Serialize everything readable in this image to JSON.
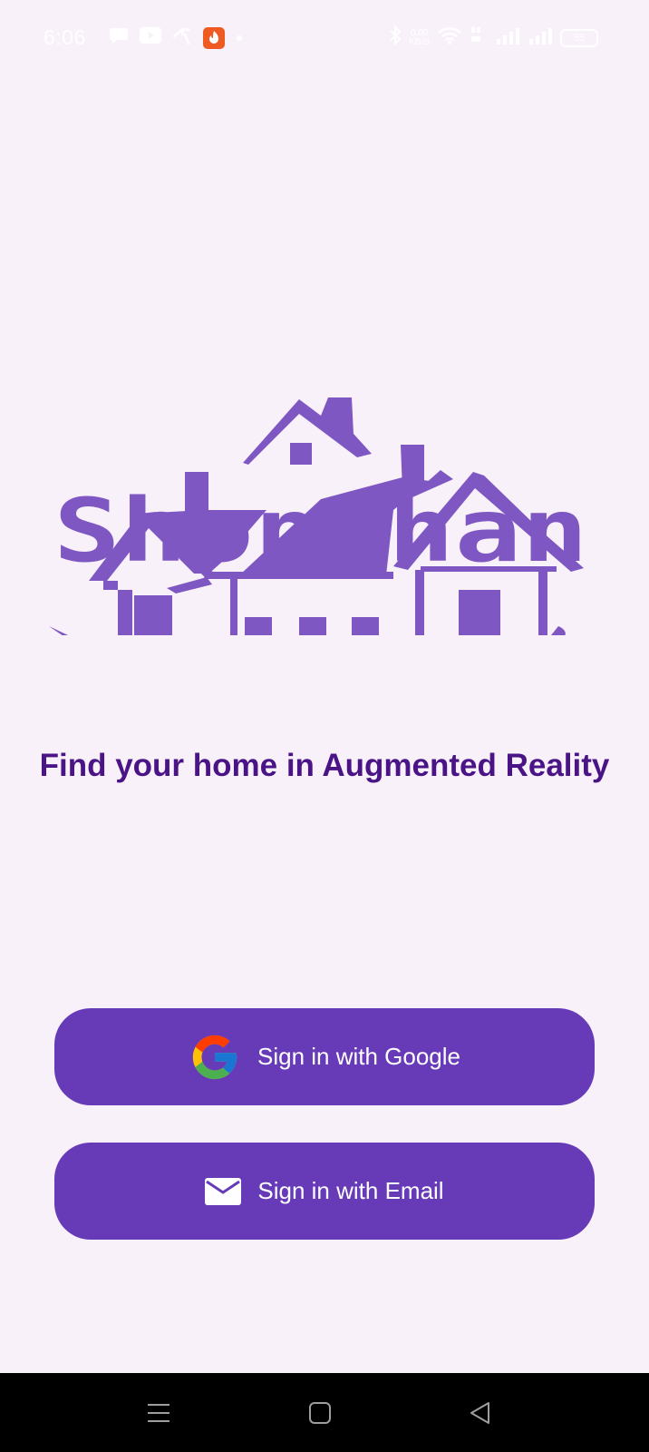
{
  "status_bar": {
    "time": "6:06",
    "net_speed_value": "0.00",
    "net_speed_unit": "KB/S",
    "battery": "55"
  },
  "brand": {
    "name": "Shondhan",
    "color": "#7e57c2"
  },
  "tagline": "Find your home in Augmented Reality",
  "buttons": {
    "google_label": "Sign in with Google",
    "email_label": "Sign in with Email",
    "color": "#673ab7"
  },
  "icons": {
    "google": "google-icon",
    "email": "mail-icon",
    "nav_menu": "menu-icon",
    "nav_home": "home-square-icon",
    "nav_back": "back-triangle-icon"
  }
}
